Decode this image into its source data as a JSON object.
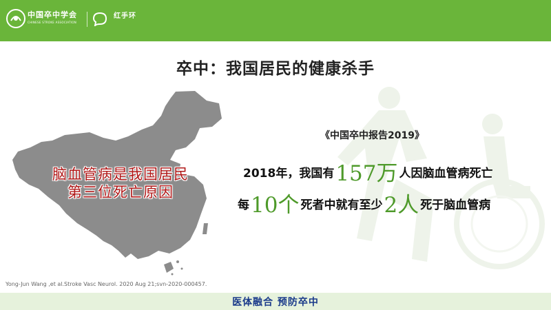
{
  "header": {
    "org_name": "中国卒中学会",
    "org_subtitle": "CHINESE STROKE ASSOCIATION",
    "partner_name": "红手环",
    "colors": {
      "bar": "#6ab53a",
      "text": "#ffffff"
    }
  },
  "title": "卒中：我国居民的健康杀手",
  "map_caption": {
    "line1": "脑血管病是我国居民",
    "line2": "第三位死亡原因",
    "color": "#b01818"
  },
  "report_label": "《中国卒中报告2019》",
  "stat1": {
    "prefix": "2018年，我国有",
    "highlight": "157万",
    "suffix": "人因脑血管病死亡"
  },
  "stat2": {
    "prefix": "每",
    "highlight": "10个",
    "middle": "死者中就有至少",
    "highlight2": "2人",
    "suffix": "死于脑血管病"
  },
  "citation": "Yong-Jun Wang ,et al.Stroke Vasc Neurol. 2020 Aug 21;svn-2020-000457.",
  "footer": {
    "slogan": "医体融合  预防卒中"
  },
  "icons": [
    "association-logo-icon",
    "red-hand-ring-logo-icon",
    "china-map-icon",
    "athlete-wheelchair-watermark-icon"
  ]
}
